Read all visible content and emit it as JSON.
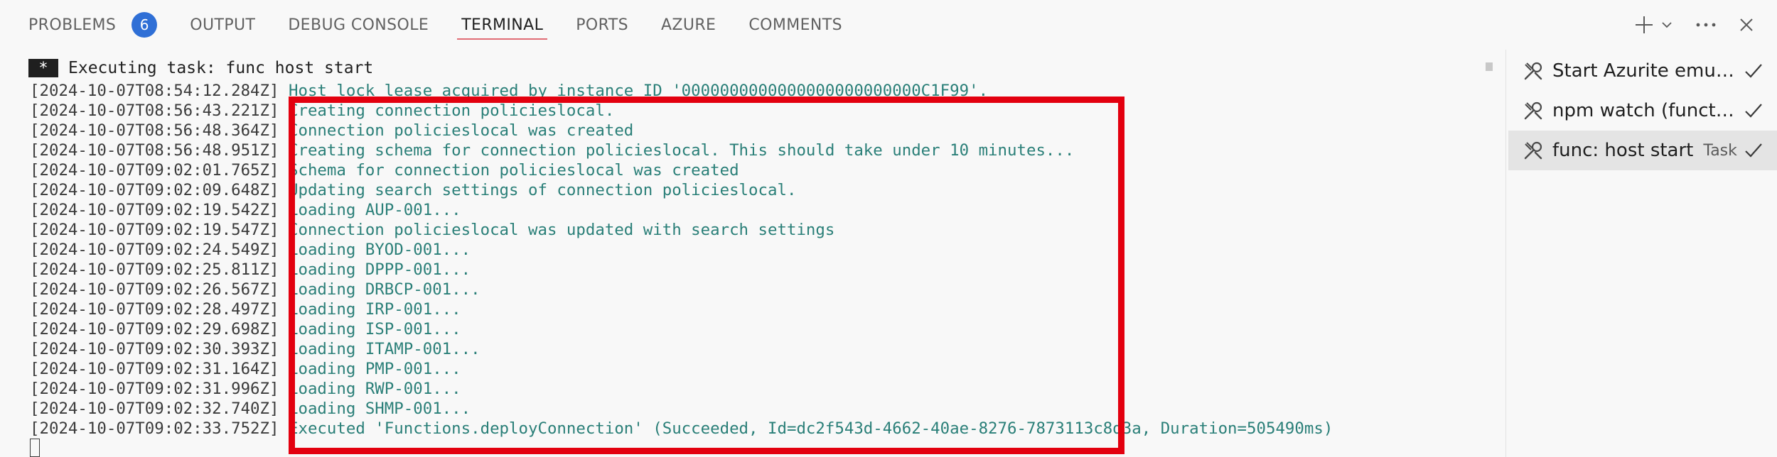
{
  "panel": {
    "tabs": [
      {
        "label": "PROBLEMS",
        "badge": "6"
      },
      {
        "label": "OUTPUT"
      },
      {
        "label": "DEBUG CONSOLE"
      },
      {
        "label": "TERMINAL",
        "active": true
      },
      {
        "label": "PORTS"
      },
      {
        "label": "AZURE"
      },
      {
        "label": "COMMENTS"
      }
    ],
    "actions": [
      "plus-icon",
      "chevron-down-icon",
      "more-icon",
      "close-icon"
    ]
  },
  "terminal": {
    "task_marker": "*",
    "task_header": "Executing task: func host start",
    "lines": [
      {
        "ts": "[2024-10-07T08:54:12.284Z]",
        "msg": "Host lock lease acquired by instance ID '0000000000000000000000000C1F99'."
      },
      {
        "ts": "[2024-10-07T08:56:43.221Z]",
        "msg": "Creating connection policieslocal."
      },
      {
        "ts": "[2024-10-07T08:56:48.364Z]",
        "msg": "Connection policieslocal was created"
      },
      {
        "ts": "[2024-10-07T08:56:48.951Z]",
        "msg": "Creating schema for connection policieslocal. This should take under 10 minutes..."
      },
      {
        "ts": "[2024-10-07T09:02:01.765Z]",
        "msg": "Schema for connection policieslocal was created"
      },
      {
        "ts": "[2024-10-07T09:02:09.648Z]",
        "msg": "Updating search settings of connection policieslocal."
      },
      {
        "ts": "[2024-10-07T09:02:19.542Z]",
        "msg": "Loading AUP-001..."
      },
      {
        "ts": "[2024-10-07T09:02:19.547Z]",
        "msg": "Connection policieslocal was updated with search settings"
      },
      {
        "ts": "[2024-10-07T09:02:24.549Z]",
        "msg": "Loading BYOD-001..."
      },
      {
        "ts": "[2024-10-07T09:02:25.811Z]",
        "msg": "Loading DPPP-001..."
      },
      {
        "ts": "[2024-10-07T09:02:26.567Z]",
        "msg": "Loading DRBCP-001..."
      },
      {
        "ts": "[2024-10-07T09:02:28.497Z]",
        "msg": "Loading IRP-001..."
      },
      {
        "ts": "[2024-10-07T09:02:29.698Z]",
        "msg": "Loading ISP-001..."
      },
      {
        "ts": "[2024-10-07T09:02:30.393Z]",
        "msg": "Loading ITAMP-001..."
      },
      {
        "ts": "[2024-10-07T09:02:31.164Z]",
        "msg": "Loading PMP-001..."
      },
      {
        "ts": "[2024-10-07T09:02:31.996Z]",
        "msg": "Loading RWP-001..."
      },
      {
        "ts": "[2024-10-07T09:02:32.740Z]",
        "msg": "Loading SHMP-001..."
      },
      {
        "ts": "[2024-10-07T09:02:33.752Z]",
        "msg": "Executed 'Functions.deployConnection' (Succeeded, Id=dc2f543d-4662-40ae-8276-7873113c8d3a, Duration=505490ms)"
      }
    ]
  },
  "task_list": [
    {
      "name": "Start Azurite emula...",
      "kind": "",
      "status_icon": "check-icon"
    },
    {
      "name": "npm watch (functio...",
      "kind": "",
      "status_icon": "check-icon"
    },
    {
      "name": "func: host start",
      "kind": "Task",
      "status_icon": "check-icon",
      "selected": true
    }
  ],
  "colors": {
    "accent_tab_underline": "#e06c75",
    "badge": "#2f6fd6",
    "log_message": "#2a7f78",
    "highlight_box": "#e3000f",
    "background": "#f8f8f8"
  }
}
